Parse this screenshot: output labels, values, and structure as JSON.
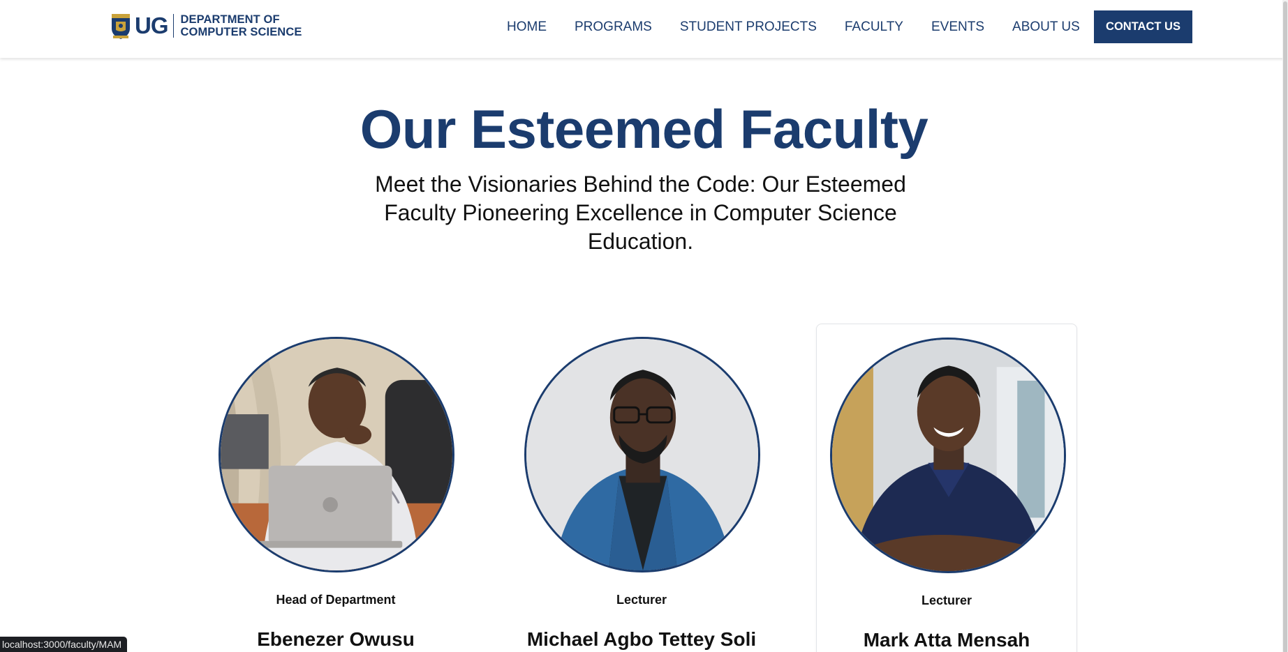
{
  "header": {
    "logo_mark": "UG",
    "logo_line1": "DEPARTMENT OF",
    "logo_line2": "COMPUTER SCIENCE",
    "nav": [
      "HOME",
      "PROGRAMS",
      "STUDENT PROJECTS",
      "FACULTY",
      "EVENTS",
      "ABOUT US"
    ],
    "contact_label": "CONTACT US"
  },
  "hero": {
    "title": "Our Esteemed Faculty",
    "subtitle": "Meet the Visionaries Behind the Code: Our Esteemed Faculty Pioneering Excellence in Computer Science Education."
  },
  "faculty": [
    {
      "role": "Head of Department",
      "name": "Ebenezer Owusu",
      "photo": "portrait-with-laptop"
    },
    {
      "role": "Lecturer",
      "name": "Michael Agbo Tettey Soli",
      "photo": "portrait-blue-blazer"
    },
    {
      "role": "Lecturer",
      "name": "Mark Atta Mensah",
      "photo": "portrait-navy-polo"
    }
  ],
  "status_url": "localhost:3000/faculty/MAM",
  "colors": {
    "brand": "#1b3c6e",
    "text": "#111111",
    "card_border": "#e2e4e8"
  }
}
